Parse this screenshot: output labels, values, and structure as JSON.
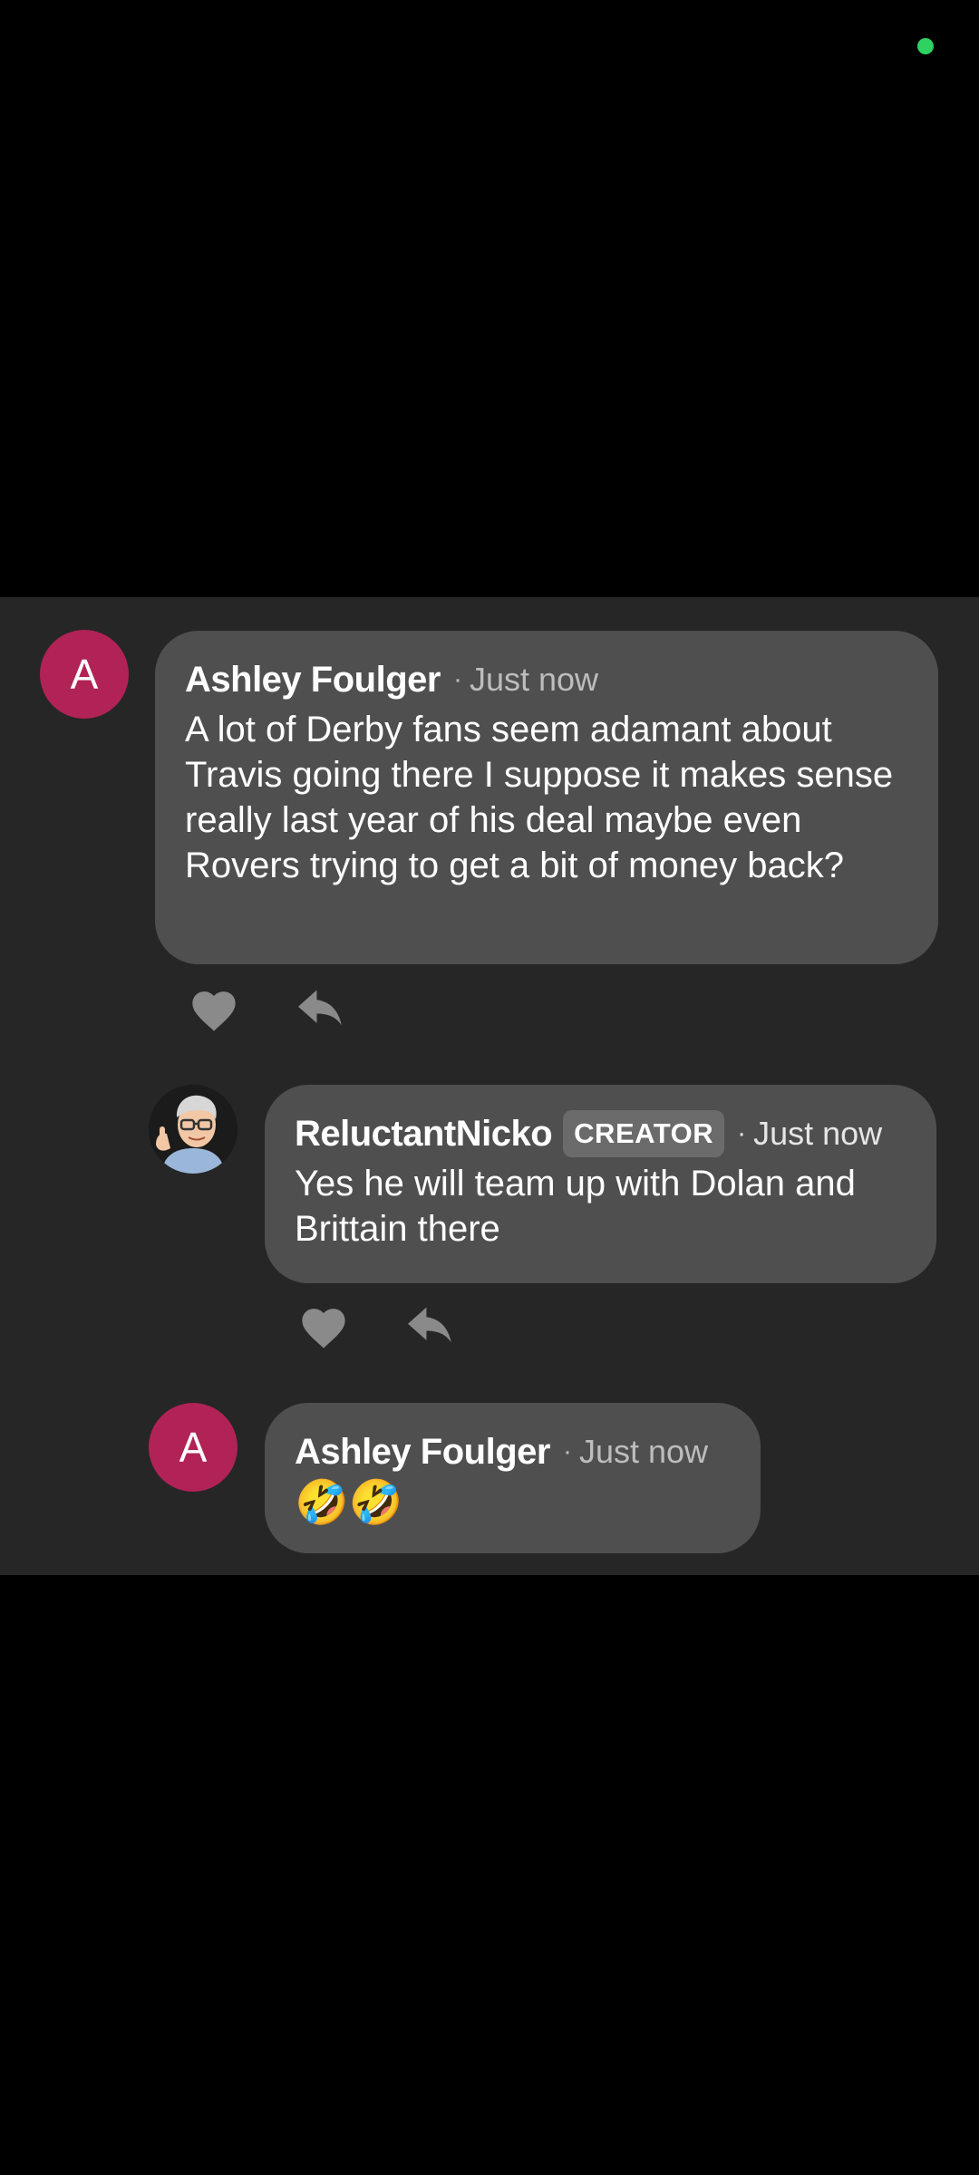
{
  "comments": [
    {
      "avatar_letter": "A",
      "author": "Ashley Foulger",
      "time": "Just now",
      "body": "A lot of Derby fans seem adamant about Travis going there I suppose it makes sense really last year of his deal maybe even Rovers trying to get a bit of money back?"
    },
    {
      "author": "ReluctantNicko",
      "badge": "CREATOR",
      "time": "Just now",
      "body": "Yes he will team up with Dolan and Brittain there"
    },
    {
      "avatar_letter": "A",
      "author": "Ashley Foulger",
      "time": "Just now",
      "body": "🤣🤣"
    }
  ],
  "separator": "·",
  "icons": {
    "like": "heart-icon",
    "reply": "reply-arrow-icon"
  },
  "colors": {
    "avatar_bg": "#b12256",
    "bubble_bg": "#4f4f4f",
    "sheet_bg": "#262626",
    "status_dot": "#2fd160"
  }
}
